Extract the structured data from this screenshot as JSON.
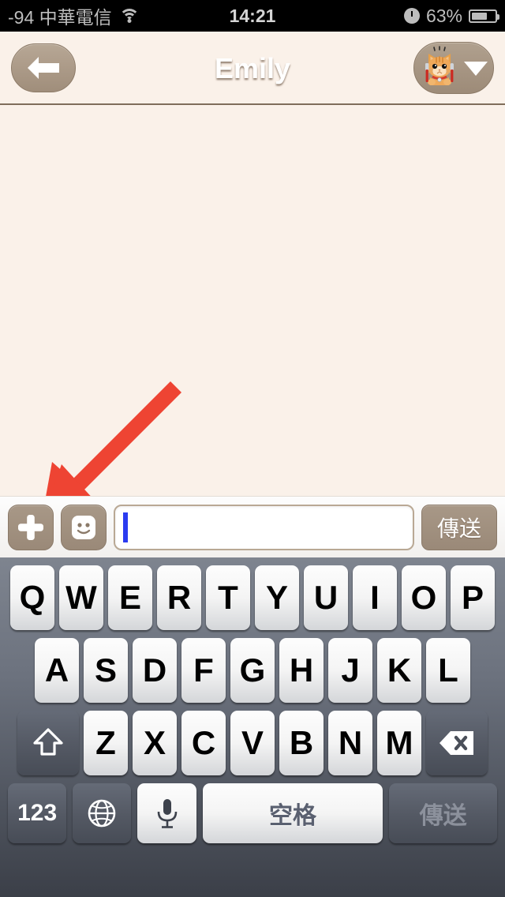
{
  "status_bar": {
    "signal_text": "-94 中華電信",
    "wifi_icon": "wifi-icon",
    "time": "14:21",
    "alarm_icon": "clock-icon",
    "battery_percent": "63%",
    "battery_icon": "battery-icon"
  },
  "nav_bar": {
    "back_icon": "back-arrow-icon",
    "title": "Emily",
    "avatar_icon": "cat-avatar-icon",
    "chevron_icon": "chevron-down-icon"
  },
  "chat": {
    "messages": []
  },
  "annotation": {
    "arrow_icon": "red-arrow-icon",
    "color": "#EE4433",
    "points_to": "plus-button"
  },
  "input_bar": {
    "plus_icon": "plus-icon",
    "sticker_icon": "smiley-face-icon",
    "input_value": "",
    "input_placeholder": "",
    "send_label": "傳送"
  },
  "keyboard": {
    "row1": [
      "Q",
      "W",
      "E",
      "R",
      "T",
      "Y",
      "U",
      "I",
      "O",
      "P"
    ],
    "row2": [
      "A",
      "S",
      "D",
      "F",
      "G",
      "H",
      "J",
      "K",
      "L"
    ],
    "row3": [
      "Z",
      "X",
      "C",
      "V",
      "B",
      "N",
      "M"
    ],
    "shift_icon": "shift-arrow-icon",
    "backspace_icon": "backspace-icon",
    "numeric_label": "123",
    "globe_icon": "globe-icon",
    "mic_icon": "microphone-icon",
    "space_label": "空格",
    "send_label": "傳送"
  },
  "colors": {
    "nav_bar": "#a09079",
    "chat_background": "#FAF1E9",
    "accent_brown": "#9a8978",
    "keyboard_background": "#5c616c",
    "annotation_red": "#EE4433",
    "caret_blue": "#2B3BF0"
  }
}
